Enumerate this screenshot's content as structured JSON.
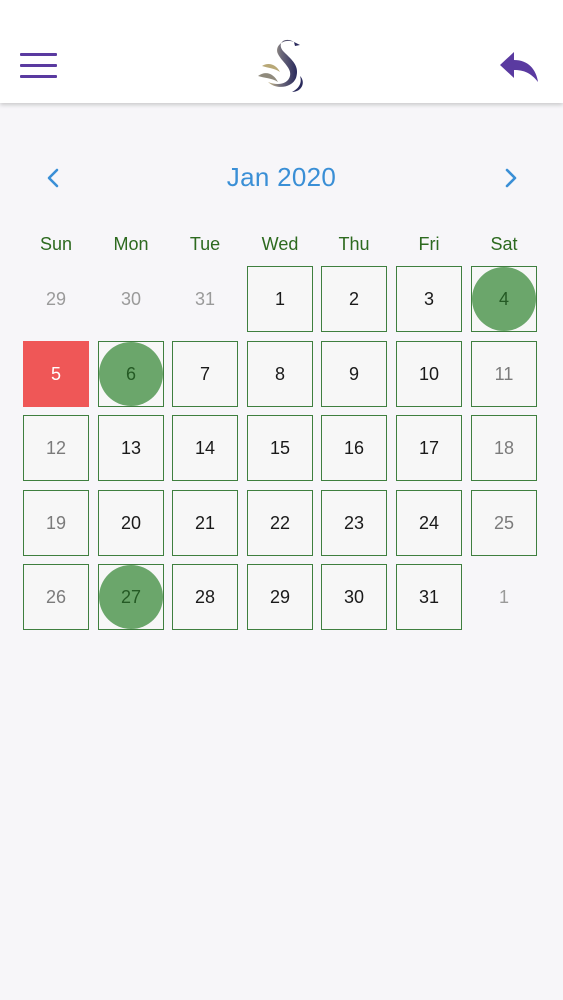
{
  "calendar": {
    "month_title": "Jan 2020",
    "weekdays": [
      "Sun",
      "Mon",
      "Tue",
      "Wed",
      "Thu",
      "Fri",
      "Sat"
    ],
    "weeks": [
      [
        {
          "d": "29",
          "type": "other"
        },
        {
          "d": "30",
          "type": "other"
        },
        {
          "d": "31",
          "type": "other"
        },
        {
          "d": "1",
          "type": "day"
        },
        {
          "d": "2",
          "type": "day"
        },
        {
          "d": "3",
          "type": "day"
        },
        {
          "d": "4",
          "type": "weekend",
          "marked": true
        }
      ],
      [
        {
          "d": "5",
          "type": "today"
        },
        {
          "d": "6",
          "type": "day",
          "marked": true
        },
        {
          "d": "7",
          "type": "day"
        },
        {
          "d": "8",
          "type": "day"
        },
        {
          "d": "9",
          "type": "day"
        },
        {
          "d": "10",
          "type": "day"
        },
        {
          "d": "11",
          "type": "weekend"
        }
      ],
      [
        {
          "d": "12",
          "type": "weekend"
        },
        {
          "d": "13",
          "type": "day"
        },
        {
          "d": "14",
          "type": "day"
        },
        {
          "d": "15",
          "type": "day"
        },
        {
          "d": "16",
          "type": "day"
        },
        {
          "d": "17",
          "type": "day"
        },
        {
          "d": "18",
          "type": "weekend"
        }
      ],
      [
        {
          "d": "19",
          "type": "weekend"
        },
        {
          "d": "20",
          "type": "day"
        },
        {
          "d": "21",
          "type": "day"
        },
        {
          "d": "22",
          "type": "day"
        },
        {
          "d": "23",
          "type": "day"
        },
        {
          "d": "24",
          "type": "day"
        },
        {
          "d": "25",
          "type": "weekend"
        }
      ],
      [
        {
          "d": "26",
          "type": "weekend"
        },
        {
          "d": "27",
          "type": "day",
          "marked": true
        },
        {
          "d": "28",
          "type": "day"
        },
        {
          "d": "29",
          "type": "day"
        },
        {
          "d": "30",
          "type": "day"
        },
        {
          "d": "31",
          "type": "day"
        },
        {
          "d": "1",
          "type": "other"
        }
      ]
    ]
  },
  "icons": {
    "menu": "hamburger-menu-icon",
    "logo": "swan-logo",
    "back": "reply-back-icon",
    "prev": "chevron-left-icon",
    "next": "chevron-right-icon"
  },
  "colors": {
    "accent": "#5a3aa0",
    "month_title": "#3a8fd6",
    "weekday": "#2d6a1f",
    "cell_border": "#3f7f3f",
    "marked": "#5e9e5e",
    "today": "#ef5757"
  }
}
